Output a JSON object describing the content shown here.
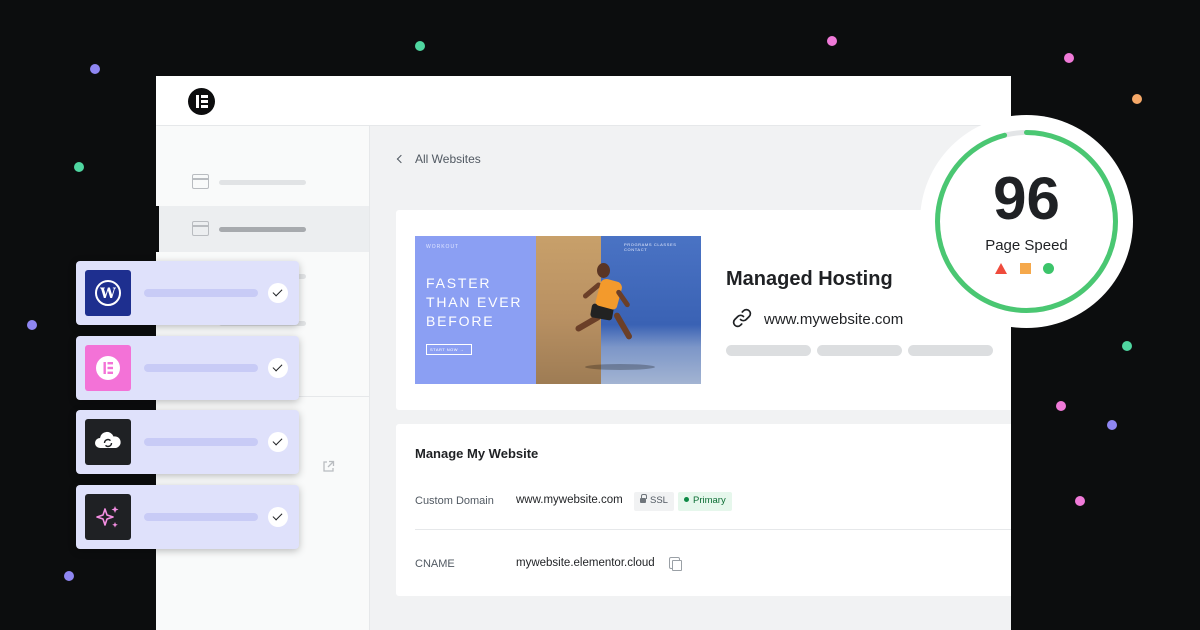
{
  "colors": {
    "background": "#0c0d0e",
    "speed_ring": "#4ac772",
    "integration_card": "#dfe1fb"
  },
  "header": {
    "logo_icon": "elementor-logo-icon"
  },
  "breadcrumb": {
    "label": "All Websites"
  },
  "website": {
    "thumbnail": {
      "brand": "WORKOUT",
      "headline_lines": [
        "FASTER",
        "THAN EVER",
        "BEFORE"
      ],
      "cta": "START NOW →",
      "nav": "PROGRAMS   CLASSES   CONTACT"
    },
    "title": "Managed Hosting",
    "url": "www.mywebsite.com"
  },
  "manage": {
    "title": "Manage My Website",
    "custom_domain_label": "Custom Domain",
    "custom_domain_value": "www.mywebsite.com",
    "ssl_badge": "SSL",
    "primary_badge": "Primary",
    "cname_label": "CNAME",
    "cname_value": "mywebsite.elementor.cloud"
  },
  "page_speed": {
    "score": "96",
    "label": "Page Speed",
    "fraction": 0.96
  },
  "integrations": [
    {
      "icon": "wordpress-icon",
      "checked": true
    },
    {
      "icon": "elementor-icon",
      "checked": true
    },
    {
      "icon": "cloud-sync-icon",
      "checked": true
    },
    {
      "icon": "ai-sparkle-icon",
      "checked": true
    }
  ]
}
